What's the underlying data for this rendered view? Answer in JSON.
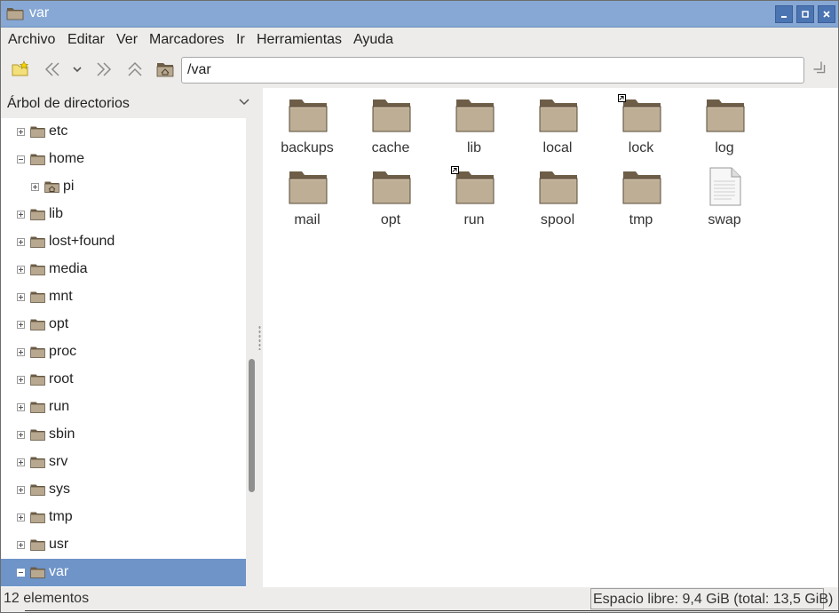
{
  "window": {
    "title": "var"
  },
  "menu": [
    "Archivo",
    "Editar",
    "Ver",
    "Marcadores",
    "Ir",
    "Herramientas",
    "Ayuda"
  ],
  "toolbar": {
    "path_value": "/var",
    "icons": [
      "new-folder-icon",
      "back-icon",
      "history-dropdown-icon",
      "forward-icon",
      "up-icon",
      "home-icon",
      "go-icon"
    ]
  },
  "side_panel": {
    "header": "Árbol de directorios",
    "tree": [
      {
        "label": "etc",
        "expander": "plus",
        "depth": 0
      },
      {
        "label": "home",
        "expander": "minus",
        "depth": 0
      },
      {
        "label": "pi",
        "expander": "plus",
        "depth": 1,
        "icon": "home-folder-icon"
      },
      {
        "label": "lib",
        "expander": "plus",
        "depth": 0
      },
      {
        "label": "lost+found",
        "expander": "plus",
        "depth": 0
      },
      {
        "label": "media",
        "expander": "plus",
        "depth": 0
      },
      {
        "label": "mnt",
        "expander": "plus",
        "depth": 0
      },
      {
        "label": "opt",
        "expander": "plus",
        "depth": 0
      },
      {
        "label": "proc",
        "expander": "plus",
        "depth": 0
      },
      {
        "label": "root",
        "expander": "plus",
        "depth": 0
      },
      {
        "label": "run",
        "expander": "plus",
        "depth": 0
      },
      {
        "label": "sbin",
        "expander": "plus",
        "depth": 0
      },
      {
        "label": "srv",
        "expander": "plus",
        "depth": 0
      },
      {
        "label": "sys",
        "expander": "plus",
        "depth": 0
      },
      {
        "label": "tmp",
        "expander": "plus",
        "depth": 0
      },
      {
        "label": "usr",
        "expander": "plus",
        "depth": 0
      },
      {
        "label": "var",
        "expander": "minus",
        "depth": 0,
        "selected": true
      }
    ]
  },
  "files": [
    {
      "name": "backups",
      "type": "folder"
    },
    {
      "name": "cache",
      "type": "folder"
    },
    {
      "name": "lib",
      "type": "folder"
    },
    {
      "name": "local",
      "type": "folder"
    },
    {
      "name": "lock",
      "type": "folder",
      "symlink": true
    },
    {
      "name": "log",
      "type": "folder"
    },
    {
      "name": "mail",
      "type": "folder"
    },
    {
      "name": "opt",
      "type": "folder"
    },
    {
      "name": "run",
      "type": "folder",
      "symlink": true
    },
    {
      "name": "spool",
      "type": "folder"
    },
    {
      "name": "tmp",
      "type": "folder"
    },
    {
      "name": "swap",
      "type": "file"
    }
  ],
  "status": {
    "items_count": "12 elementos",
    "free_space": "Espacio libre: 9,4 GiB (total: 13,5 GiB)"
  },
  "colors": {
    "titlebar": "#87a8d4",
    "selection": "#6e94c8",
    "folder": "#b5a68e"
  }
}
